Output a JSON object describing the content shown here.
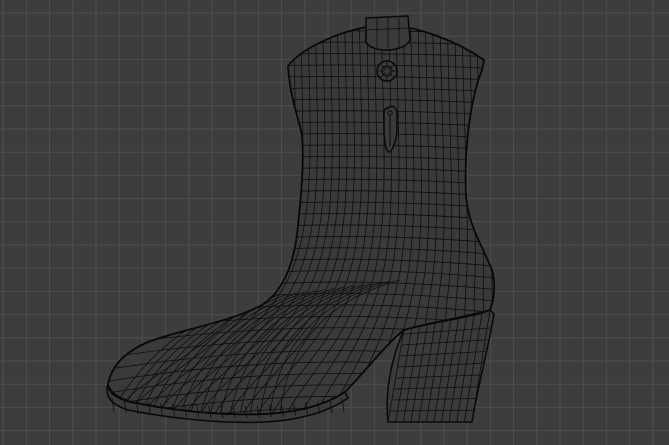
{
  "viewport": {
    "background": "#3d3d3d",
    "grid_color": "#4f4f4f",
    "grid_minor_color": "#474747",
    "mesh_fill": "#3a3a3a",
    "mesh_line": "#0e0e0e",
    "outline": "#080808"
  },
  "object": {
    "name": "cowboy-boot",
    "icon_parts": [
      "pull-tab",
      "rivet",
      "zipper-pull"
    ]
  }
}
